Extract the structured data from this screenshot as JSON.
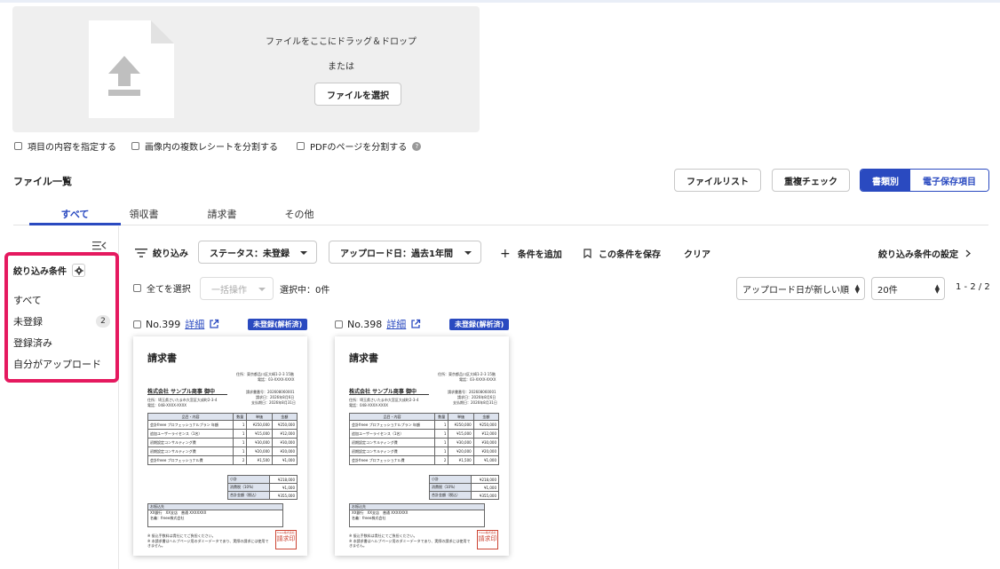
{
  "upload": {
    "drop_text": "ファイルをここにドラッグ＆ドロップ",
    "or_text": "または",
    "select_button": "ファイルを選択"
  },
  "options": {
    "specify_items": "項目の内容を指定する",
    "split_receipts": "画像内の複数レシートを分割する",
    "split_pdf": "PDFのページを分割する"
  },
  "file_list": {
    "title": "ファイル一覧",
    "file_list_button": "ファイルリスト",
    "duplicate_check_button": "重複チェック",
    "by_type_button": "書類別",
    "e_storage_button": "電子保存項目"
  },
  "tabs": [
    "すべて",
    "領収書",
    "請求書",
    "その他"
  ],
  "sidebar": {
    "title": "絞り込み条件",
    "items": [
      {
        "label": "すべて"
      },
      {
        "label": "未登録",
        "count": "2"
      },
      {
        "label": "登録済み"
      },
      {
        "label": "自分がアップロード"
      }
    ]
  },
  "filter_bar": {
    "label": "絞り込み",
    "status": "ステータス：未登録",
    "upload_date": "アップロード日：過去1年間",
    "add_condition": "条件を追加",
    "save_condition": "この条件を保存",
    "clear": "クリア",
    "settings": "絞り込み条件の設定"
  },
  "list_controls": {
    "select_all": "全てを選択",
    "bulk_action": "一括操作",
    "selected": "選択中：0件",
    "sort": "アップロード日が新しい順",
    "per_page": "20件",
    "pager": "1 - 2 / 2"
  },
  "cards": [
    {
      "number": "No.399",
      "detail": "詳細",
      "badge": "未登録(解析済)"
    },
    {
      "number": "No.398",
      "detail": "詳細",
      "badge": "未登録(解析済)"
    }
  ],
  "invoice": {
    "title": "請求書",
    "issuer_address": "住所：東京都品川区大崎1-2-3 15階",
    "issuer_phone": "電話：03-XXXX-XXXX",
    "customer": "株式会社 サンプル商事 御中",
    "invoice_no": "請求書番号：202608060001",
    "issue_date": "請求日：2026年8月6日",
    "due_date": "支払期日：2026年8月31日",
    "customer_address": "住所：埼玉県さいたま市大宮区大成町2-3-4",
    "customer_phone": "電話：048-XXXX-XXXX",
    "headers": [
      "品目・内容",
      "数量",
      "単価",
      "金額"
    ],
    "rows": [
      [
        "会計freee プロフェッショナルプラン 年額",
        "1",
        "¥250,000",
        "¥250,000"
      ],
      [
        "追加ユーザーライセンス（1名）",
        "1",
        "¥15,000",
        "¥12,000"
      ],
      [
        "初期設定コンサルティング費",
        "1",
        "¥30,000",
        "¥30,000"
      ],
      [
        "初期設定コンサルティング費",
        "1",
        "¥20,000",
        "¥20,000"
      ],
      [
        "会計freee プロフェッショナル費",
        "2",
        "¥1,500",
        "¥1,000"
      ]
    ],
    "subtotal_label": "小計",
    "subtotal": "¥218,000",
    "tax_label": "消費税（10%）",
    "tax": "¥1,000",
    "total_label": "合計金額（税込）",
    "total": "¥355,000",
    "bank_header": "お振込先",
    "bank_line1": "XX銀行　XX支店　普通 XXXXXXX",
    "bank_line2": "名義：freee株式会社",
    "note1": "※ 振込手数料は貴社にてご負担ください。",
    "note2": "※ 本請求書はヘルプページ用のダミーデータであり、実際の請求には使用できません。",
    "stamp_small": "freee株式会社",
    "stamp": "請求印"
  }
}
